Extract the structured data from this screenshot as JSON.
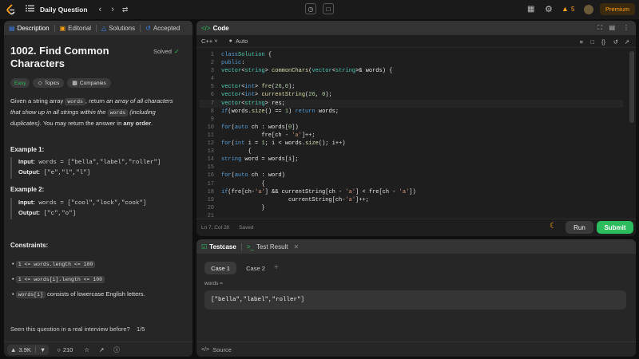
{
  "topbar": {
    "title": "Daily Question",
    "streak": "5",
    "premium": "Premium"
  },
  "left_tabs": [
    "Description",
    "Editorial",
    "Solutions",
    "Accepted"
  ],
  "problem": {
    "title_line1": "1002. Find Common",
    "title_line2": "Characters",
    "status": "Solved",
    "difficulty": "Easy",
    "topics": "Topics",
    "companies": "Companies",
    "desc_p1": "Given a string array ",
    "desc_code1": "words",
    "desc_p2": ", return ",
    "desc_em1": "an array of all characters",
    "desc_em2": "that show up in all strings within the",
    "desc_code2": "words",
    "desc_em3": "(including",
    "desc_em4": "duplicates)",
    "desc_p3": ". You may return the answer in ",
    "desc_b": "any order",
    "desc_p4": "."
  },
  "examples": [
    {
      "heading": "Example 1:",
      "input_label": "Input:",
      "input": "words = [\"bella\",\"label\",\"roller\"]",
      "output_label": "Output:",
      "output": "[\"e\",\"l\",\"l\"]"
    },
    {
      "heading": "Example 2:",
      "input_label": "Input:",
      "input": "words = [\"cool\",\"lock\",\"cook\"]",
      "output_label": "Output:",
      "output": "[\"c\",\"o\"]"
    }
  ],
  "constraints": {
    "heading": "Constraints:",
    "items": [
      "1 <= words.length <= 100",
      "1 <= words[i].length <= 100"
    ],
    "item3_code": "words[i]",
    "item3_text": " consists of lowercase English letters."
  },
  "interview_question": "Seen this question in a real interview before?",
  "interview_page": "1/5",
  "footer": {
    "likes": "3.9K",
    "comments": "210"
  },
  "code_panel": {
    "title": "Code",
    "language": "C++",
    "mode": "Auto",
    "status": "Ln 7, Col 28",
    "saved": "Saved",
    "run": "Run",
    "submit": "Submit",
    "line_numbers": [
      "1",
      "2",
      "3",
      "4",
      "5",
      "6",
      "7",
      "8",
      "9",
      "10",
      "11",
      "12",
      "13",
      "14",
      "15",
      "16",
      "17",
      "18",
      "19",
      "20",
      "21"
    ]
  },
  "testcase": {
    "tab1": "Testcase",
    "tab2": "Test Result",
    "case1": "Case 1",
    "case2": "Case 2",
    "var_label": "words =",
    "value": "[\"bella\",\"label\",\"roller\"]",
    "source": "Source"
  },
  "colors": {
    "accent_green": "#2cbb5d",
    "easy": "#2cbb5d",
    "premium": "#ffa116"
  }
}
